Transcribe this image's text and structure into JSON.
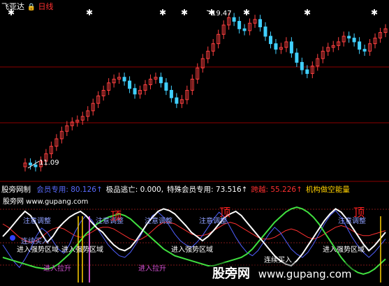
{
  "header": {
    "stock_name": "飞亚达",
    "period": "日线",
    "period_icon": "lock-icon",
    "colors": {
      "stock_name": "#ffffff",
      "period": "#ff3030"
    }
  },
  "price_panel": {
    "high_label": "19.47",
    "low_label": "11.09",
    "star_symbol": "✱",
    "colors": {
      "up": "#ff4040",
      "down": "#40d0ff",
      "grid": "#8b0000"
    }
  },
  "indicator_header": {
    "name": "股旁网制",
    "items": [
      {
        "label": "会员专用:",
        "value": "80.126",
        "arrow": "↑",
        "color": "#5a6bff"
      },
      {
        "label": "极品逃亡:",
        "value": "0.000,",
        "arrow": "",
        "color": "#ffffff"
      },
      {
        "label": "特殊会员专用:",
        "value": "73.516",
        "arrow": "↑",
        "color": "#ffffff"
      },
      {
        "label": "跨越:",
        "value": "55.226",
        "arrow": "↑",
        "color": "#ff3030"
      },
      {
        "label": "机构做空能量",
        "value": "",
        "arrow": "",
        "color": "#ffd000"
      }
    ]
  },
  "watermark": {
    "top_left": "股旁网 www.gupang.com",
    "bottom_right_cn": "股旁网",
    "bottom_right_url": "www.gupang.com"
  },
  "annotations": [
    {
      "text": "注意调整",
      "color": "#8fa0ff"
    },
    {
      "text": "注意调整",
      "color": "#8fa0ff"
    },
    {
      "text": "注意调整",
      "color": "#8fa0ff"
    },
    {
      "text": "注意调整",
      "color": "#8fa0ff"
    },
    {
      "text": "注意调整",
      "color": "#8fa0ff"
    },
    {
      "text": "顶",
      "color": "#ff2020"
    },
    {
      "text": "顶",
      "color": "#ff2020"
    },
    {
      "text": "顶",
      "color": "#ff2020"
    },
    {
      "text": "进入强势区域",
      "color": "#ffffff"
    },
    {
      "text": "进入强势区域",
      "color": "#ffffff"
    },
    {
      "text": "进入强势区域",
      "color": "#ffffff"
    },
    {
      "text": "进入强势区域",
      "color": "#ffffff"
    },
    {
      "text": "进入拉升",
      "color": "#d050d0"
    },
    {
      "text": "进入拉升",
      "color": "#d050d0"
    },
    {
      "text": "连续买入",
      "color": "#ffffff"
    },
    {
      "text": "连续买入",
      "color": "#8fa0ff"
    }
  ],
  "chart_data": {
    "type": "line",
    "price": {
      "high": 19.47,
      "low": 11.09,
      "close": [
        11.4,
        11.3,
        11.2,
        11.5,
        11.9,
        12.3,
        12.7,
        13.1,
        13.4,
        13.6,
        13.7,
        13.9,
        14.2,
        14.6,
        15.0,
        15.3,
        15.7,
        15.9,
        16.0,
        15.8,
        15.4,
        15.1,
        15.3,
        15.6,
        15.9,
        16.0,
        15.7,
        15.3,
        14.9,
        14.6,
        14.8,
        15.3,
        15.9,
        16.5,
        17.0,
        17.4,
        17.8,
        18.3,
        18.8,
        19.2,
        19.0,
        18.6,
        18.5,
        18.9,
        19.1,
        18.7,
        18.2,
        17.8,
        17.5,
        17.6,
        17.9,
        17.3,
        16.8,
        16.4,
        16.2,
        16.6,
        17.0,
        17.4,
        17.6,
        17.7,
        17.9,
        18.2,
        18.1,
        17.9,
        17.5,
        17.4,
        17.8,
        18.1,
        18.4,
        18.6
      ]
    },
    "series": [
      {
        "name": "会员专用",
        "color": "#ffffff",
        "values": [
          55,
          62,
          70,
          78,
          85,
          80,
          70,
          58,
          48,
          55,
          65,
          72,
          78,
          82,
          85,
          80,
          72,
          65,
          60,
          52,
          45,
          40,
          38,
          42,
          50,
          60,
          70,
          78,
          85,
          88,
          86,
          82,
          75,
          68,
          60,
          55,
          50,
          55,
          62,
          70,
          78,
          82,
          85,
          80,
          72,
          64,
          56,
          48,
          40,
          32,
          26,
          22,
          20,
          26,
          34,
          44,
          54,
          64,
          74,
          82,
          88,
          84,
          76,
          66,
          56,
          46,
          38,
          44,
          52,
          60
        ]
      },
      {
        "name": "特殊会员专用",
        "color": "#40e040",
        "values": [
          30,
          28,
          26,
          24,
          22,
          20,
          18,
          17,
          16,
          18,
          22,
          28,
          34,
          42,
          50,
          58,
          64,
          70,
          74,
          78,
          80,
          82,
          80,
          76,
          70,
          64,
          58,
          52,
          46,
          40,
          36,
          32,
          30,
          28,
          26,
          24,
          22,
          20,
          20,
          22,
          24,
          26,
          28,
          30,
          34,
          40,
          48,
          56,
          64,
          72,
          78,
          84,
          88,
          90,
          88,
          84,
          78,
          70,
          60,
          50,
          40,
          30,
          22,
          16,
          12,
          10,
          12,
          16,
          22,
          28
        ]
      },
      {
        "name": "跨越",
        "color": "#5060ff",
        "values": [
          45,
          35,
          25,
          18,
          28,
          40,
          55,
          65,
          60,
          50,
          40,
          35,
          45,
          60,
          72,
          80,
          75,
          65,
          55,
          45,
          38,
          32,
          30,
          36,
          46,
          58,
          70,
          80,
          84,
          78,
          68,
          58,
          50,
          45,
          42,
          48,
          56,
          66,
          76,
          84,
          78,
          66,
          54,
          44,
          36,
          32,
          38,
          48,
          58,
          66,
          60,
          50,
          40,
          34,
          30,
          36,
          46,
          58,
          70,
          80,
          86,
          78,
          66,
          54,
          44,
          36,
          30,
          36,
          44,
          52
        ]
      },
      {
        "name": "机构做空能量",
        "color": "#ff3030",
        "values": [
          70,
          66,
          60,
          54,
          50,
          48,
          50,
          54,
          60,
          64,
          66,
          64,
          60,
          56,
          54,
          56,
          60,
          64,
          66,
          66,
          64,
          60,
          56,
          52,
          50,
          52,
          56,
          62,
          68,
          72,
          72,
          70,
          66,
          62,
          58,
          56,
          56,
          58,
          62,
          66,
          70,
          72,
          70,
          66,
          62,
          58,
          54,
          52,
          52,
          54,
          58,
          62,
          64,
          62,
          58,
          54,
          52,
          54,
          58,
          62,
          66,
          68,
          66,
          62,
          58,
          56,
          56,
          58,
          60,
          62
        ]
      }
    ],
    "ylim": [
      0,
      100
    ],
    "title": "",
    "xlabel": "",
    "ylabel": ""
  }
}
